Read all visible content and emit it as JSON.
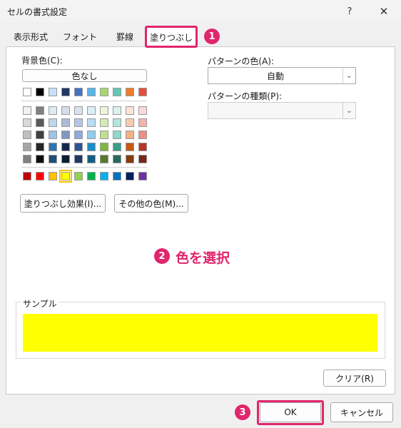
{
  "window": {
    "title": "セルの書式設定",
    "help_label": "?",
    "close_label": "✕"
  },
  "tabs": [
    "表示形式",
    "フォント",
    "罫線",
    "塗りつぶし"
  ],
  "fill": {
    "background_label": "背景色(C):",
    "no_color_label": "色なし",
    "fill_effects_label": "塗りつぶし効果(I)...",
    "more_colors_label": "その他の色(M)...",
    "pattern_color_label": "パターンの色(A):",
    "pattern_color_value": "自動",
    "pattern_style_label": "パターンの種類(P):",
    "pattern_style_value": "",
    "selected_color": "#ffff00",
    "theme_top_row": [
      "#ffffff",
      "#000000",
      "#c9e1f6",
      "#1f3864",
      "#4472c4",
      "#5ab4e6",
      "#a9d86e",
      "#64c8b4",
      "#f07c2e",
      "#e84c3d"
    ],
    "theme_shades": [
      [
        "#f2f2f2",
        "#7f7f7f",
        "#deebf7",
        "#d6dcea",
        "#d9e2f3",
        "#dbeef8",
        "#eaf5d9",
        "#d9f2ec",
        "#fce4d6",
        "#f8dad7"
      ],
      [
        "#d9d9d9",
        "#595959",
        "#bdd7ee",
        "#adb9d5",
        "#b4c6e7",
        "#b6ddf2",
        "#d5ebb4",
        "#b3e6da",
        "#f8cbad",
        "#f1b5ae"
      ],
      [
        "#bfbfbf",
        "#404040",
        "#9dc3e6",
        "#8497c1",
        "#8faadc",
        "#92ccec",
        "#c0e18e",
        "#8cd9c7",
        "#f4b183",
        "#eb9085"
      ],
      [
        "#a6a6a6",
        "#262626",
        "#2e75b6",
        "#17294b",
        "#2f5597",
        "#1e8cc4",
        "#7fb63c",
        "#3a9e88",
        "#c55a11",
        "#b7362a"
      ],
      [
        "#808080",
        "#0d0d0d",
        "#1f4e79",
        "#0f1c32",
        "#1f3864",
        "#145d83",
        "#557a28",
        "#276a5b",
        "#843c0c",
        "#7a241c"
      ]
    ],
    "standard_colors": [
      "#c00000",
      "#ff0000",
      "#ffc000",
      "#ffff00",
      "#92d050",
      "#00b050",
      "#00b0f0",
      "#0070c0",
      "#002060",
      "#7030a0"
    ],
    "annotation_text": "色を選択"
  },
  "sample": {
    "label": "サンプル",
    "clear_label": "クリア(R)"
  },
  "footer": {
    "ok_label": "OK",
    "cancel_label": "キャンセル"
  },
  "badges": {
    "tab": "1",
    "color": "2",
    "ok": "3"
  },
  "accent": "#e0266c"
}
